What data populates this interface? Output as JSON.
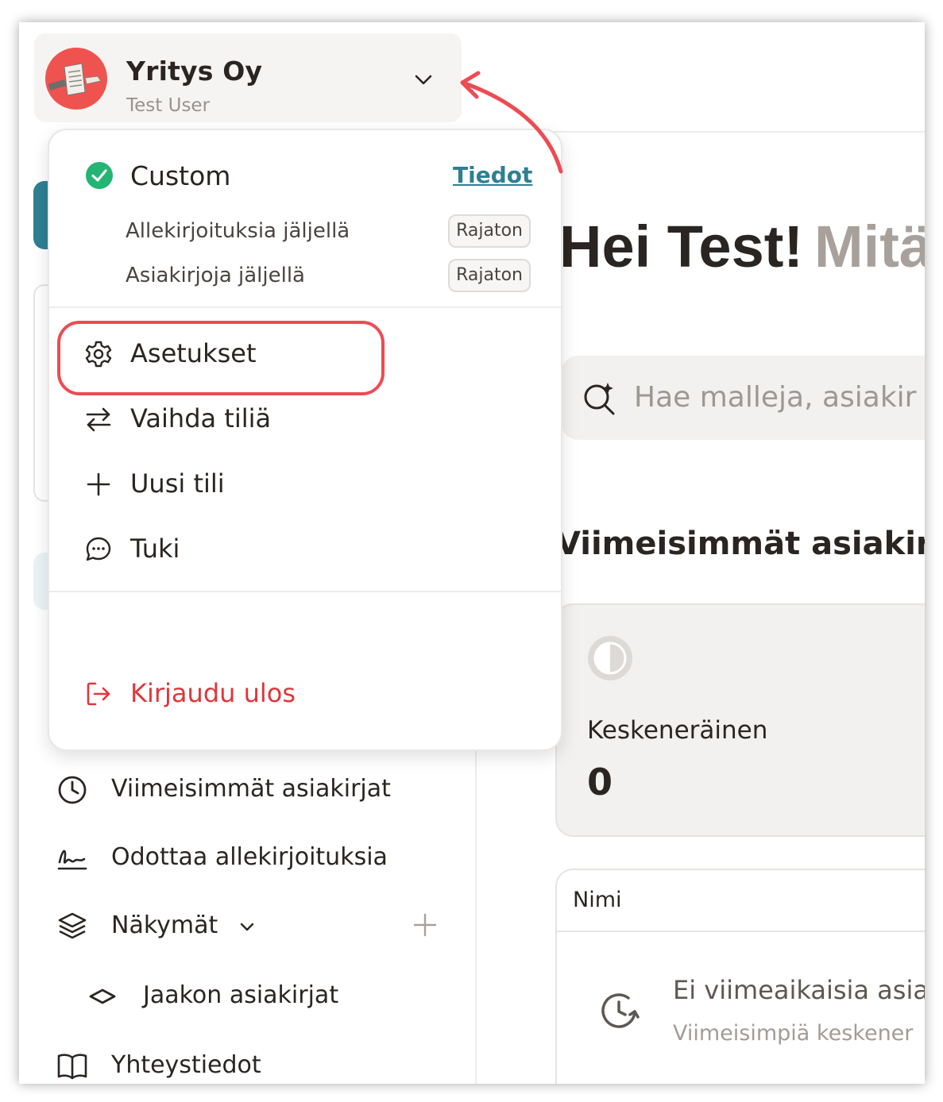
{
  "account": {
    "name": "Yritys Oy",
    "user": "Test User"
  },
  "main": {
    "greeting": "Hei Test!",
    "greeting_sub": "Mitä",
    "search_placeholder": "Hae malleja, asiakir",
    "recent_heading": "Viimeisimmät asiakirj",
    "stat": {
      "label": "Keskeneräinen",
      "value": "0"
    },
    "table": {
      "column_header": "Nimi",
      "empty_title": "Ei viimeaikaisia asia",
      "empty_subtitle": "Viimeisimpiä keskener"
    }
  },
  "sidebar": {
    "items": [
      {
        "label": "Viimeisimmät asiakirjat",
        "icon": "clock-icon"
      },
      {
        "label": "Odottaa allekirjoituksia",
        "icon": "signature-icon"
      },
      {
        "label": "Näkymät",
        "icon": "layers-icon"
      },
      {
        "label": "Jaakon asiakirjat",
        "icon": "diamond-icon"
      },
      {
        "label": "Yhteystiedot",
        "icon": "book-icon"
      }
    ]
  },
  "dropdown": {
    "plan": {
      "name": "Custom",
      "link": "Tiedot"
    },
    "quotas": [
      {
        "label": "Allekirjoituksia jäljellä",
        "value": "Rajaton"
      },
      {
        "label": "Asiakirjoja jäljellä",
        "value": "Rajaton"
      }
    ],
    "menu": [
      {
        "label": "Asetukset",
        "icon": "gear-icon"
      },
      {
        "label": "Vaihda tiliä",
        "icon": "swap-icon"
      },
      {
        "label": "Uusi tili",
        "icon": "plus-icon"
      },
      {
        "label": "Tuki",
        "icon": "chat-icon"
      }
    ],
    "logout": {
      "label": "Kirjaudu ulos",
      "icon": "logout-icon"
    }
  },
  "colors": {
    "accent": "#2f7f94",
    "annotation": "#ee4b53",
    "success": "#22b573",
    "danger": "#e0363c",
    "avatar": "#ef5350"
  }
}
